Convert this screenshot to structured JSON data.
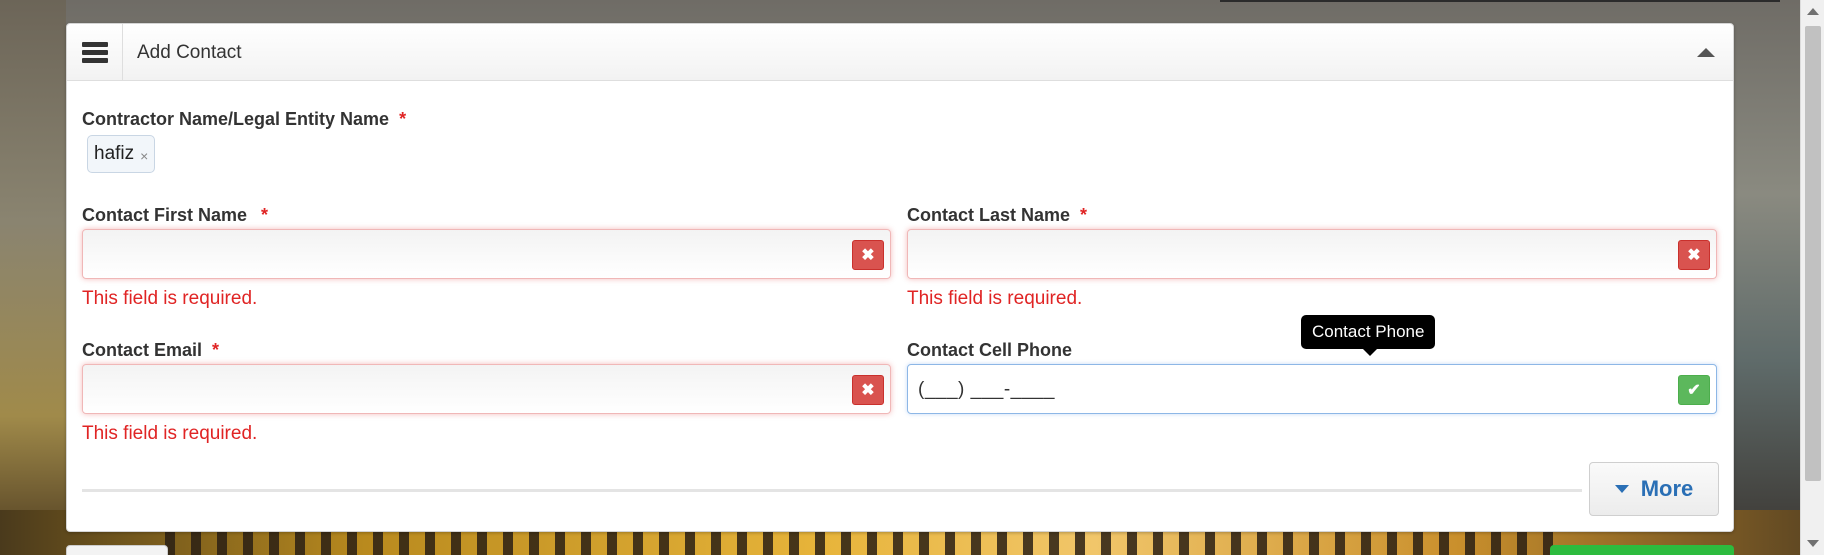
{
  "panel": {
    "title": "Add Contact"
  },
  "contractor": {
    "label": "Contractor Name/Legal Entity Name",
    "required_mark": "*",
    "tag": "hafiz",
    "tag_remove": "×"
  },
  "first_name": {
    "label": "Contact First Name",
    "required_mark": "*",
    "value": "",
    "error": "This field is required."
  },
  "last_name": {
    "label": "Contact Last Name",
    "required_mark": "*",
    "value": "",
    "error": "This field is required."
  },
  "email": {
    "label": "Contact Email",
    "required_mark": "*",
    "value": "",
    "error": "This field is required."
  },
  "cell_phone": {
    "label": "Contact Cell Phone",
    "value": "(___) ___-____",
    "tooltip": "Contact Phone"
  },
  "more_button": {
    "label": "More"
  },
  "status_icons": {
    "error": "✖",
    "valid": "✔"
  },
  "colors": {
    "error": "#e02424",
    "valid": "#5cb85c",
    "link": "#2a6fb5"
  }
}
